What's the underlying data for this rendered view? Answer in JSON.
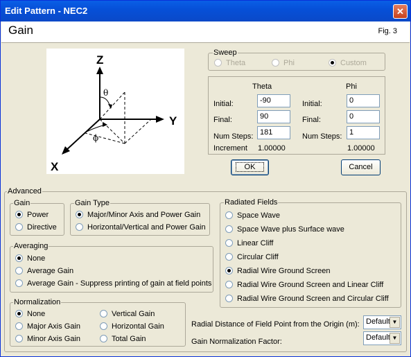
{
  "window": {
    "title": "Edit Pattern - NEC2",
    "close_glyph": "✕"
  },
  "header": {
    "title": "Gain",
    "fig": "Fig. 3"
  },
  "diagram": {
    "z": "Z",
    "y": "Y",
    "x": "X",
    "theta": "θ",
    "phi": "ϕ"
  },
  "sweep": {
    "legend": "Sweep",
    "options": [
      {
        "label": "Theta",
        "selected": false
      },
      {
        "label": "Phi",
        "selected": false
      },
      {
        "label": "Custom",
        "selected": true
      }
    ]
  },
  "angles": {
    "theta_header": "Theta",
    "phi_header": "Phi",
    "initial_label": "Initial:",
    "final_label": "Final:",
    "steps_label": "Num Steps:",
    "increment_label": "Increment",
    "theta": {
      "initial": "-90",
      "final": "90",
      "steps": "181",
      "increment": "1.00000"
    },
    "phi": {
      "initial": "0",
      "final": "0",
      "steps": "1",
      "increment": "1.00000"
    }
  },
  "buttons": {
    "ok": "OK",
    "cancel": "Cancel"
  },
  "advanced": {
    "legend": "Advanced"
  },
  "gain": {
    "legend": "Gain",
    "options": [
      "Power",
      "Directive"
    ]
  },
  "gain_type": {
    "legend": "Gain Type",
    "options": [
      "Major/Minor Axis and Power Gain",
      "Horizontal/Vertical and Power Gain"
    ]
  },
  "averaging": {
    "legend": "Averaging",
    "options": [
      "None",
      "Average Gain",
      "Average Gain - Suppress printing of gain at field points"
    ]
  },
  "normalization": {
    "legend": "Normalization",
    "options": [
      "None",
      "Major Axis Gain",
      "Minor Axis Gain",
      "Vertical Gain",
      "Horizontal Gain",
      "Total Gain"
    ]
  },
  "radiated": {
    "legend": "Radiated Fields",
    "options": [
      "Space Wave",
      "Space Wave plus Surface wave",
      "Linear Cliff",
      "Circular Cliff",
      "Radial Wire Ground Screen",
      "Radial Wire Ground Screen and Linear Cliff",
      "Radial Wire Ground Screen and Circular Cliff"
    ]
  },
  "radial_distance": {
    "label": "Radial Distance of Field Point from the Origin (m):",
    "value": "Default"
  },
  "gain_norm_factor": {
    "label": "Gain Normalization Factor:",
    "value": "Default"
  }
}
